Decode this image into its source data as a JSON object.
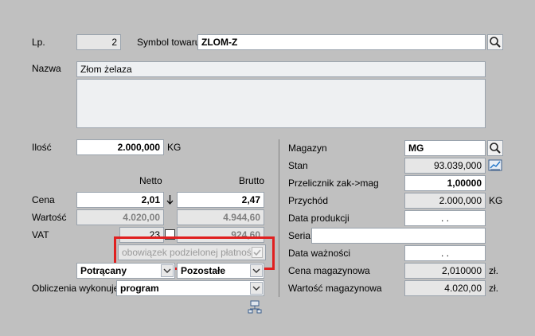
{
  "labels": {
    "lp": "Lp.",
    "symbol": "Symbol towaru",
    "nazwa": "Nazwa",
    "ilosc": "Ilość",
    "netto": "Netto",
    "brutto": "Brutto",
    "cena": "Cena",
    "wartosc": "Wartość",
    "vat": "VAT",
    "obliczenia": "Obliczenia wykonuje:",
    "magazyn": "Magazyn",
    "stan": "Stan",
    "przelicznik": "Przelicznik zak->mag",
    "przychod": "Przychód",
    "data_produkcji": "Data produkcji",
    "seria": "Seria",
    "data_waznosci": "Data ważności",
    "cena_magazynowa": "Cena magazynowa",
    "wartosc_magazynowa": "Wartość magazynowa"
  },
  "values": {
    "lp": "2",
    "symbol": "ZLOM-Z",
    "nazwa": "Złom żelaza",
    "ilosc": "2.000,000",
    "ilosc_unit": "KG",
    "cena_netto": "2,01",
    "cena_brutto": "2,47",
    "wartosc_netto": "4.020,00",
    "wartosc_brutto": "4.944,60",
    "vat_rate": "23",
    "vat_amount": "924,60",
    "split_payment": "obowiązek podzielonej płatności",
    "potracany": "Potrącany",
    "pozostale": "Pozostałe",
    "obliczenia": "program",
    "magazyn": "MG",
    "stan": "93.039,000",
    "przelicznik": "1,00000",
    "przychod": "2.000,000",
    "przychod_unit": "KG",
    "data_produkcji": ". .",
    "seria": "",
    "data_waznosci": ". .",
    "cena_magazynowa": "2,010000",
    "cena_unit": "zł.",
    "wartosc_magazynowa": "4.020,00",
    "wartosc_unit": "zł."
  },
  "colors": {
    "highlight_box": "#e02020",
    "background": "#c0c0c0"
  }
}
